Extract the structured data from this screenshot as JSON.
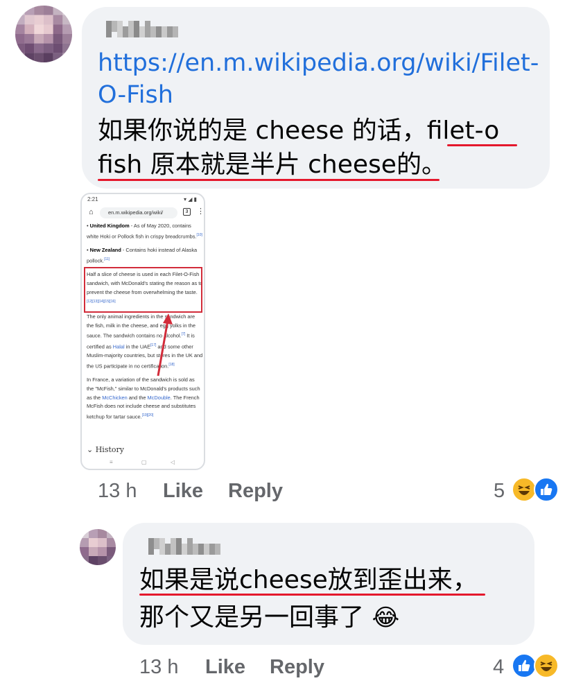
{
  "comments": [
    {
      "link": "https://en.m.wikipedia.org/wiki/Filet-O-Fish",
      "text_line1": "如果你说的是 cheese 的话，",
      "text_line1_underlined": "filet-o",
      "text_line2_underlined": "fish 原本就是半片 cheese的",
      "text_line2_end": "。",
      "time": "13 h",
      "like_label": "Like",
      "reply_label": "Reply",
      "reaction_count": "5",
      "reactions": [
        "haha",
        "like"
      ],
      "attachment": {
        "status_left": "2:21",
        "status_right": "▾ ◢ ▮",
        "url": "en.m.wikipedia.org/wiki/",
        "tabs_count": "3",
        "p1_title": "United Kingdom",
        "p1_text": " - As of May 2020, contains white Hoki or Pollock fish in crispy breadcrumbs.",
        "p1_ref": "[10]",
        "p2_title": "New Zealand",
        "p2_text": " - Contains hoki instead of Alaska pollock.",
        "p2_ref": "[11]",
        "p3_text": "Half a slice of cheese is used in each Filet-O-Fish sandwich, with McDonald's stating the reason as to prevent the cheese from overwhelming the taste.",
        "p3_ref": "[12][13][14][15][16]",
        "p4_text_a": "The only animal ingredients in the sandwich are the fish, milk in the cheese, and egg yolks in the sauce. The sandwich contains no alcohol.",
        "p4_ref1": "[7]",
        "p4_text_b": " It is certified as ",
        "p4_halal": "Halal",
        "p4_text_c": " in the UAE",
        "p4_ref2": "[17]",
        "p4_text_d": " and some other Muslim-majority countries, but stores in the UK and the US participate in no certification.",
        "p4_ref3": "[18]",
        "p5_text_a": "In France, a variation of the sandwich is sold as the \"McFish,\" similar to McDonald's products such as the ",
        "p5_mcchicken": "McChicken",
        "p5_text_b": " and the ",
        "p5_mcdouble": "McDouble",
        "p5_text_c": ". The French McFish does not include cheese and substitutes ketchup for tartar sauce.",
        "p5_ref": "[19][20]",
        "history": "History"
      }
    },
    {
      "text_line1_underlined": "如果是说cheese放到歪出来",
      "text_line1_end": "，",
      "text_line2": "那个又是另一回事了",
      "emoji": "😂",
      "time": "13 h",
      "like_label": "Like",
      "reply_label": "Reply",
      "reaction_count": "4",
      "reactions": [
        "like",
        "haha"
      ]
    }
  ],
  "colors": {
    "bubble": "#f0f2f5",
    "link": "#216fdb",
    "underline": "#e4182c",
    "meta": "#65676b",
    "like_blue": "#1877f2",
    "haha_yellow": "#f7b928"
  }
}
